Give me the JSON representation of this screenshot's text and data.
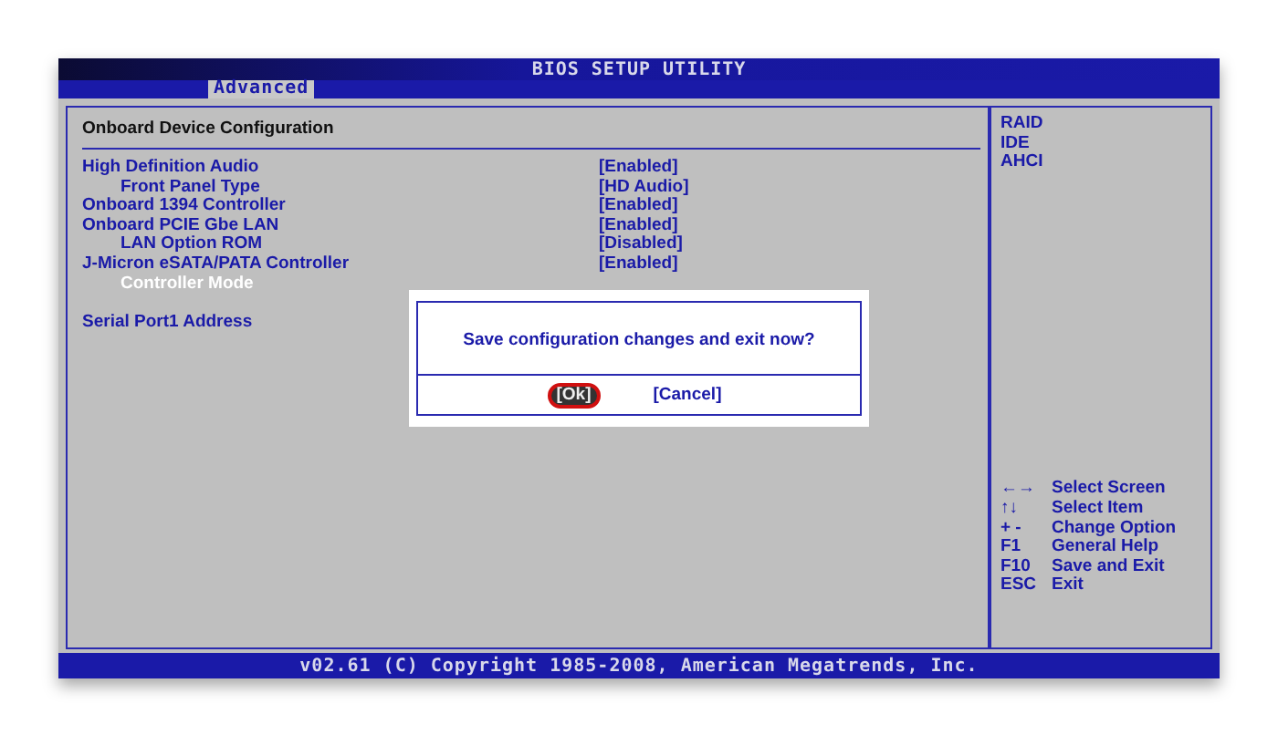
{
  "window": {
    "title": "BIOS SETUP UTILITY"
  },
  "tabs": [
    {
      "label": "Advanced",
      "selected": true
    }
  ],
  "panel": {
    "title": "Onboard Device Configuration",
    "items": [
      {
        "label": "High Definition Audio",
        "value": "[Enabled]",
        "highlighted": false,
        "children": [
          {
            "label": "Front Panel Type",
            "value": "[HD Audio]",
            "highlighted": false
          }
        ]
      },
      {
        "label": "Onboard 1394 Controller",
        "value": "[Enabled]",
        "highlighted": false
      },
      {
        "label": "Onboard PCIE Gbe LAN",
        "value": "[Enabled]",
        "highlighted": false,
        "children": [
          {
            "label": "LAN Option ROM",
            "value": "[Disabled]",
            "highlighted": false
          }
        ]
      },
      {
        "label": "J-Micron eSATA/PATA Controller",
        "value": "[Enabled]",
        "highlighted": false,
        "children": [
          {
            "label": "Controller Mode",
            "highlighted": true
          }
        ]
      },
      {
        "label": "Serial Port1 Address",
        "highlighted": false,
        "gap_before": true
      }
    ]
  },
  "options": [
    "RAID",
    "IDE",
    "AHCI"
  ],
  "keys": [
    {
      "key": "←→",
      "action": "Select Screen"
    },
    {
      "key": "↑↓",
      "action": "Select Item"
    },
    {
      "key": "+ -",
      "action": "Change Option"
    },
    {
      "key": "F1",
      "action": "General Help"
    },
    {
      "key": "F10",
      "action": "Save and Exit"
    },
    {
      "key": "ESC",
      "action": "Exit"
    }
  ],
  "dialog": {
    "message": "Save configuration changes and exit now?",
    "buttons": [
      {
        "label": "[Ok]",
        "selected": true
      },
      {
        "label": "[Cancel]",
        "selected": false
      }
    ]
  },
  "status_bar": "v02.61 (C) Copyright 1985-2008, American Megatrends, Inc."
}
